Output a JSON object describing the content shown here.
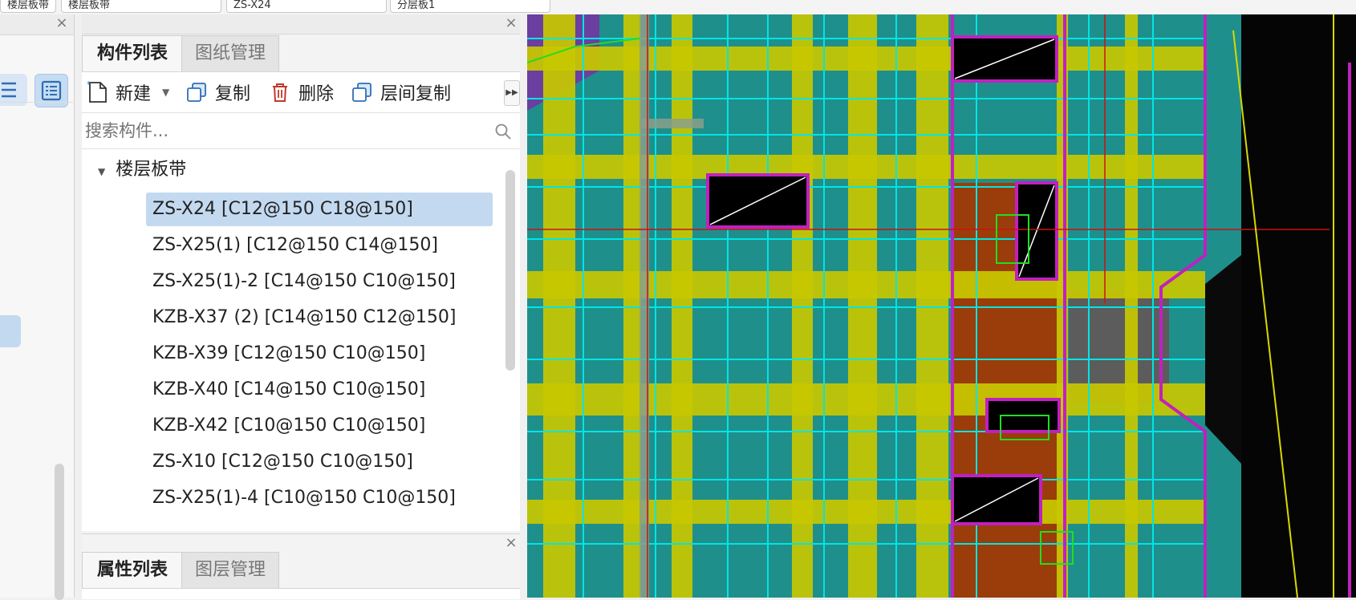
{
  "top_bar": {
    "combo1": "楼层板带",
    "combo2": "ZS-X24",
    "combo3": "分层板1"
  },
  "component_panel": {
    "tabs": [
      "构件列表",
      "图纸管理"
    ],
    "toolbar": {
      "new_label": "新建",
      "copy_label": "复制",
      "delete_label": "删除",
      "floor_copy_label": "层间复制"
    },
    "search_placeholder": "搜索构件...",
    "tree": {
      "group_label": "楼层板带",
      "items": [
        "ZS-X24 [C12@150 C18@150]",
        "ZS-X25(1) [C12@150 C14@150]",
        "ZS-X25(1)-2 [C14@150 C10@150]",
        "KZB-X37 (2)  [C14@150 C12@150]",
        "KZB-X39 [C12@150 C10@150]",
        "KZB-X40 [C14@150 C10@150]",
        "KZB-X42 [C10@150 C10@150]",
        "ZS-X10 [C12@150 C10@150]",
        "ZS-X25(1)-4 [C10@150 C10@150]"
      ],
      "selected_index": 0
    }
  },
  "property_panel": {
    "tabs": [
      "属性列表",
      "图层管理"
    ]
  },
  "colors": {
    "selection": "#c3d9f0",
    "cad_slab": "#1f8f8c",
    "cad_band": "#c8c800",
    "cad_brown": "#9a3d0a",
    "cad_magenta": "#c020c0",
    "cad_cyan": "#00e5e5"
  }
}
